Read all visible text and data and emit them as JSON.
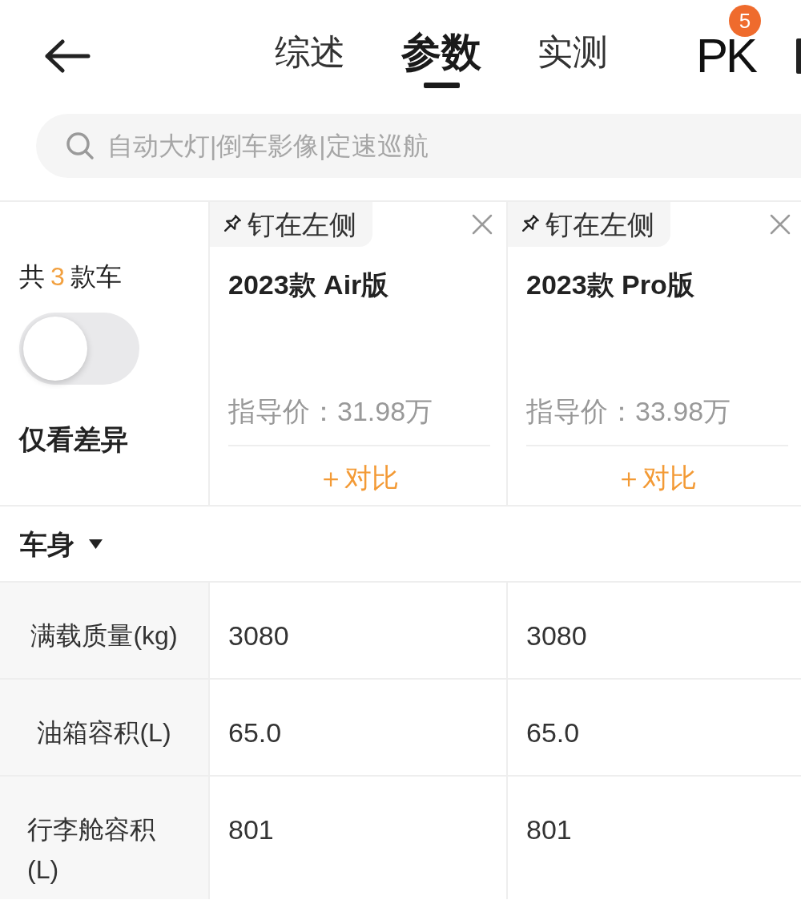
{
  "nav": {
    "tabs": [
      {
        "label": "综述",
        "selected": false
      },
      {
        "label": "参数",
        "selected": true
      },
      {
        "label": "实测",
        "selected": false
      }
    ],
    "pk": {
      "label": "PK",
      "badge": "5"
    }
  },
  "search": {
    "placeholder": "自动大灯|倒车影像|定速巡航"
  },
  "summary": {
    "before": "共",
    "count": "3",
    "after": "款车"
  },
  "diff_toggle": {
    "label": "仅看差异",
    "on": false
  },
  "cars": [
    {
      "pin_label": "钉在左侧",
      "name": "2023款 Air版",
      "price": "指导价：31.98万",
      "compare": "＋对比"
    },
    {
      "pin_label": "钉在左侧",
      "name": "2023款 Pro版",
      "price": "指导价：33.98万",
      "compare": "＋对比"
    }
  ],
  "sections": [
    {
      "title": "车身",
      "expanded": true,
      "rows": [
        {
          "label": "满载质量(kg)",
          "values": [
            "3080",
            "3080"
          ]
        },
        {
          "label": "油箱容积(L)",
          "values": [
            "65.0",
            "65.0"
          ]
        },
        {
          "label": "行李舱容积(L)",
          "values": [
            "801",
            "801"
          ]
        }
      ]
    }
  ]
}
